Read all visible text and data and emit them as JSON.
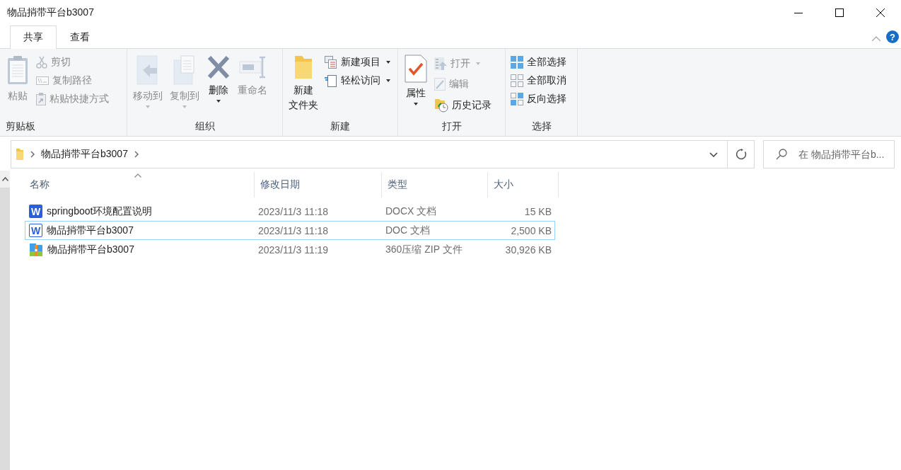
{
  "window": {
    "title": "物品捎带平台b3007"
  },
  "tabs": [
    {
      "label": "共享",
      "selected": true
    },
    {
      "label": "查看",
      "selected": false
    }
  ],
  "help": "?",
  "ribbon": {
    "groups": [
      {
        "label": "剪贴板",
        "items": [
          {
            "label": "粘贴",
            "kind": "large",
            "disabled": true,
            "dropdown": false
          },
          {
            "label": "剪切",
            "kind": "small",
            "disabled": true,
            "dropdown": false
          },
          {
            "label": "复制路径",
            "kind": "small",
            "disabled": true,
            "dropdown": false
          },
          {
            "label": "粘贴快捷方式",
            "kind": "small",
            "disabled": true,
            "dropdown": false
          }
        ]
      },
      {
        "label": "组织",
        "items": [
          {
            "label": "移动到",
            "kind": "large",
            "disabled": true,
            "dropdown": true
          },
          {
            "label": "复制到",
            "kind": "large",
            "disabled": true,
            "dropdown": true
          },
          {
            "label": "删除",
            "kind": "large",
            "disabled": false,
            "dropdown": true
          },
          {
            "label": "重命名",
            "kind": "large",
            "disabled": true,
            "dropdown": false
          }
        ]
      },
      {
        "label": "新建",
        "items": [
          {
            "label": "新建文件夹",
            "kind": "large",
            "disabled": false,
            "dropdown": false
          },
          {
            "label": "新建项目",
            "kind": "small",
            "disabled": false,
            "dropdown": true
          },
          {
            "label": "轻松访问",
            "kind": "small",
            "disabled": false,
            "dropdown": true
          }
        ]
      },
      {
        "label": "打开",
        "items": [
          {
            "label": "属性",
            "kind": "large",
            "disabled": false,
            "dropdown": true
          },
          {
            "label": "打开",
            "kind": "small",
            "disabled": true,
            "dropdown": true
          },
          {
            "label": "编辑",
            "kind": "small",
            "disabled": true,
            "dropdown": false
          },
          {
            "label": "历史记录",
            "kind": "small",
            "disabled": false,
            "dropdown": false
          }
        ]
      },
      {
        "label": "选择",
        "items": [
          {
            "label": "全部选择",
            "kind": "small",
            "disabled": false,
            "dropdown": false
          },
          {
            "label": "全部取消",
            "kind": "small",
            "disabled": false,
            "dropdown": false
          },
          {
            "label": "反向选择",
            "kind": "small",
            "disabled": false,
            "dropdown": false
          }
        ]
      }
    ]
  },
  "address": {
    "path": "物品捎带平台b3007"
  },
  "search": {
    "placeholder": "在 物品捎带平台b..."
  },
  "table": {
    "columns": [
      "名称",
      "修改日期",
      "类型",
      "大小"
    ],
    "rows": [
      {
        "kind": "docx",
        "icon_text": "W",
        "name": "springboot环境配置说明",
        "date": "2023/11/3 11:18",
        "type": "DOCX 文档",
        "size": "15 KB",
        "selected": false
      },
      {
        "kind": "doc",
        "icon_text": "W",
        "name": "物品捎带平台b3007",
        "date": "2023/11/3 11:18",
        "type": "DOC 文档",
        "size": "2,500 KB",
        "selected": true
      },
      {
        "kind": "zip",
        "name": "物品捎带平台b3007",
        "date": "2023/11/3 11:19",
        "type": "360压缩 ZIP 文件",
        "size": "30,926 KB",
        "selected": false
      }
    ]
  }
}
